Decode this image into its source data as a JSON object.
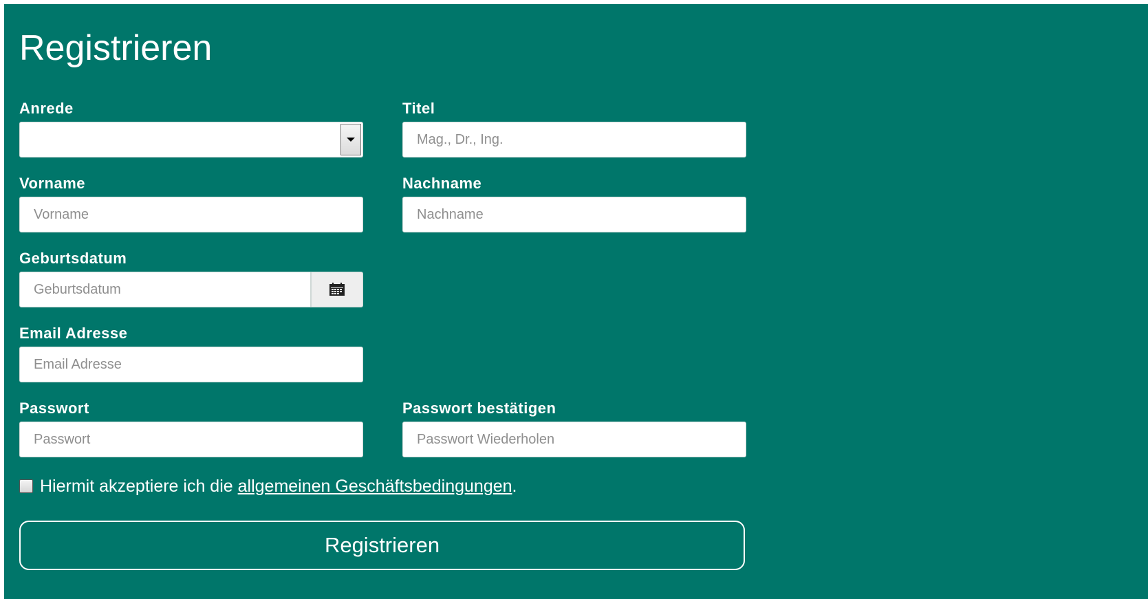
{
  "page": {
    "title": "Registrieren"
  },
  "form": {
    "anrede": {
      "label": "Anrede",
      "value": ""
    },
    "titel": {
      "label": "Titel",
      "placeholder": "Mag., Dr., Ing."
    },
    "vorname": {
      "label": "Vorname",
      "placeholder": "Vorname"
    },
    "nachname": {
      "label": "Nachname",
      "placeholder": "Nachname"
    },
    "geburtsdatum": {
      "label": "Geburtsdatum",
      "placeholder": "Geburtsdatum",
      "icon": "calendar-icon"
    },
    "email": {
      "label": "Email Adresse",
      "placeholder": "Email Adresse"
    },
    "passwort": {
      "label": "Passwort",
      "placeholder": "Passwort"
    },
    "passwort_confirm": {
      "label": "Passwort bestätigen",
      "placeholder": "Passwort Wiederholen"
    },
    "terms": {
      "prefix": "Hiermit akzeptiere ich die ",
      "link": "allgemeinen Geschäftsbedingungen",
      "suffix": ".",
      "checked": false
    },
    "submit_label": "Registrieren"
  },
  "colors": {
    "background": "#00766a",
    "text": "#ffffff"
  }
}
